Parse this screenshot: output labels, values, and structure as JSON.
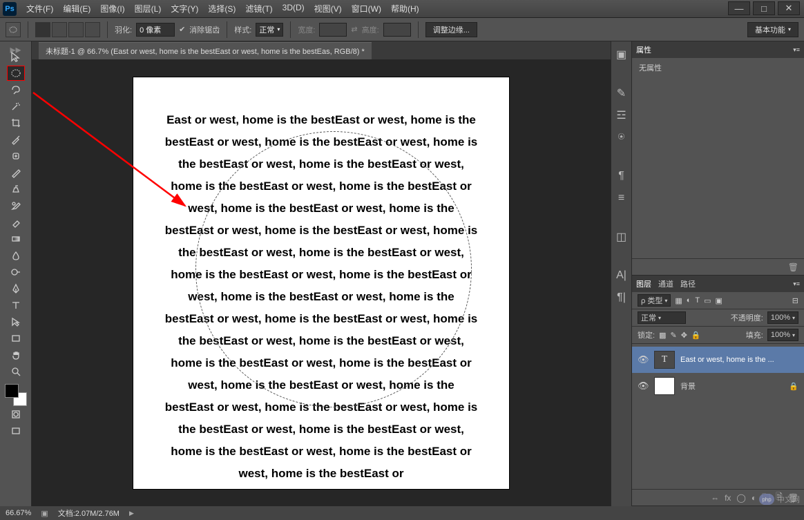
{
  "menu": {
    "items": [
      "文件(F)",
      "编辑(E)",
      "图像(I)",
      "图层(L)",
      "文字(Y)",
      "选择(S)",
      "滤镜(T)",
      "3D(D)",
      "视图(V)",
      "窗口(W)",
      "帮助(H)"
    ]
  },
  "options": {
    "feather_label": "羽化:",
    "feather_value": "0 像素",
    "antialias": "消除锯齿",
    "style_label": "样式:",
    "style_value": "正常",
    "width_label": "宽度:",
    "height_label": "高度:",
    "refine": "调整边缘...",
    "workspace": "基本功能"
  },
  "tab_title": "未标题-1 @ 66.7% (East or west, home is the bestEast or west, home is the bestEas, RGB/8) *",
  "canvas_text": "East or west, home is the bestEast or west, home is the bestEast or west, home is the bestEast or west, home is the bestEast or west, home is the bestEast or west, home is the bestEast or west, home is the bestEast or west, home is the bestEast or west, home is the bestEast or west, home is the bestEast or west, home is the bestEast or west, home is the bestEast or west, home is the bestEast or west, home is the bestEast or west, home is the bestEast or west, home is the bestEast or west, home is the bestEast or west, home is the bestEast or west, home is the bestEast or west, home is the bestEast or west, home is the bestEast or west, home is the bestEast or west, home is the bestEast or west, home is the bestEast or west, home is the bestEast or west, home is the bestEast or west, home is the bestEast or west, home is the bestEast or west, home is the bestEast or",
  "panels": {
    "properties_tab": "属性",
    "no_properties": "无属性",
    "layers_tab": "图层",
    "channels_tab": "通道",
    "paths_tab": "路径",
    "kind_label": "ρ 类型",
    "blend_mode": "正常",
    "opacity_label": "不透明度:",
    "opacity_value": "100%",
    "lock_label": "锁定:",
    "fill_label": "填充:",
    "fill_value": "100%",
    "layer_text": "East or west, home is the ...",
    "layer_bg": "背景"
  },
  "status": {
    "zoom": "66.67%",
    "doc": "文档:2.07M/2.76M"
  },
  "badge": "中文网"
}
